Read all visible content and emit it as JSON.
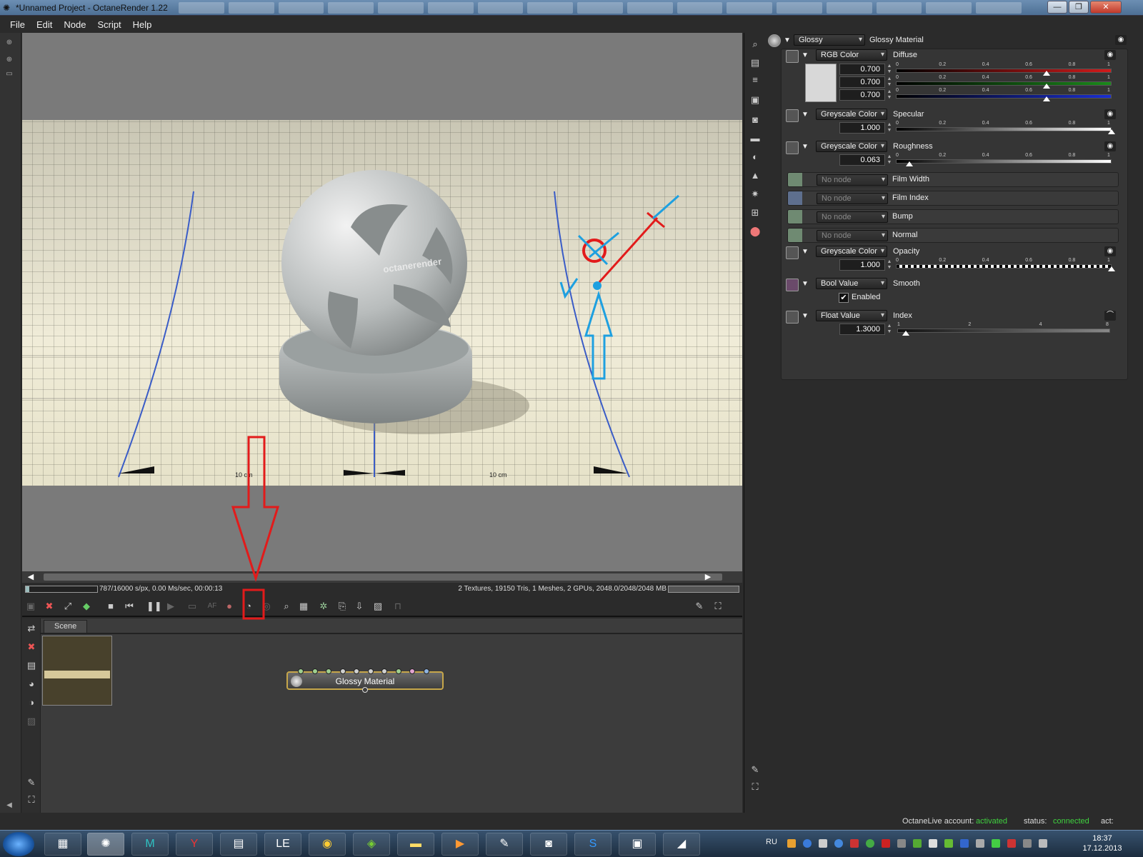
{
  "window": {
    "title": "*Unnamed Project - OctaneRender 1.22",
    "minimize": "—",
    "maximize": "❐",
    "close": "✕"
  },
  "menu": [
    "File",
    "Edit",
    "Node",
    "Script",
    "Help"
  ],
  "render_status": {
    "progress_fraction": 0.049,
    "stats": "787/16000 s/px, 0.00 Ms/sec, 00:00:13",
    "info": "2 Textures, 19150 Tris, 1 Meshes, 2 GPUs, 2048.0/2048/2048 MB"
  },
  "viewport_overlay": {
    "watermark": "octanerender",
    "ruler_left": "10 cm",
    "ruler_right": "10 cm"
  },
  "render_toolbar": {
    "icons": [
      "save-render-icon",
      "clear-icon",
      "fit-icon",
      "cube-icon",
      "stop-icon",
      "restart-icon",
      "pause-icon",
      "start-icon",
      "region-icon",
      "af-icon",
      "color-picker-icon",
      "material-picker-icon",
      "focus-picker-icon",
      "camera-picker-icon",
      "film-region-icon",
      "lock-icon",
      "preset-icon",
      "export-icon",
      "import-icon",
      "lock-viewport-icon"
    ],
    "af_label": "AF",
    "highlighted": "material-picker-icon"
  },
  "nodegraph": {
    "tab": "Scene",
    "node_label": "Glossy Material",
    "pin_colors": [
      "#9fcf8f",
      "#9fcf8f",
      "#9fcf8f",
      "#cfd0cf",
      "#cfd0cf",
      "#cfd0cf",
      "#cfd0cf",
      "#9fcf8f",
      "#e3a3d0",
      "#8fb3df"
    ]
  },
  "inspector": {
    "header": {
      "type": "Glossy",
      "name": "Glossy Material"
    },
    "diffuse": {
      "type": "RGB Color",
      "label": "Diffuse",
      "values": [
        "0.700",
        "0.700",
        "0.700"
      ],
      "channel_fractions": [
        0.7,
        0.7,
        0.7
      ],
      "channel_colors": [
        "#d11a1a",
        "#1a8a1a",
        "#1a2ed1"
      ],
      "ticks": [
        "0",
        "0.2",
        "0.4",
        "0.6",
        "0.8",
        "1"
      ]
    },
    "specular": {
      "type": "Greyscale Color",
      "label": "Specular",
      "value": "1.000",
      "fraction": 1.0
    },
    "roughness": {
      "type": "Greyscale Color",
      "label": "Roughness",
      "value": "0.063",
      "fraction": 0.063
    },
    "film_width": {
      "type": "No node",
      "label": "Film Width"
    },
    "film_index": {
      "type": "No node",
      "label": "Film Index"
    },
    "bump": {
      "type": "No node",
      "label": "Bump"
    },
    "normal": {
      "type": "No node",
      "label": "Normal"
    },
    "opacity": {
      "type": "Greyscale Color",
      "label": "Opacity",
      "value": "1.000",
      "fraction": 1.0
    },
    "smooth": {
      "type": "Bool Value",
      "label": "Smooth",
      "checkbox_label": "Enabled",
      "checked": true
    },
    "index": {
      "type": "Float Value",
      "label": "Index",
      "value": "1.3000",
      "fraction": 0.04,
      "ticks": [
        "1",
        "2",
        "4",
        "8"
      ]
    }
  },
  "octane_status": {
    "account_label": "OctaneLive account:",
    "account_value": "activated",
    "status_label": "status:",
    "status_value": "connected",
    "act_label": "act:"
  },
  "taskbar": {
    "apps": [
      "monitor-app",
      "octane-app",
      "maya-app",
      "yandex-app",
      "calculator-app",
      "le-app",
      "chrome-app",
      "nvidia-app",
      "explorer-app",
      "media-app",
      "paint-app",
      "video-app",
      "skype-app",
      "photos-app",
      "alias-app"
    ],
    "lang": "RU",
    "time": "18:37",
    "date": "17.12.2013"
  }
}
